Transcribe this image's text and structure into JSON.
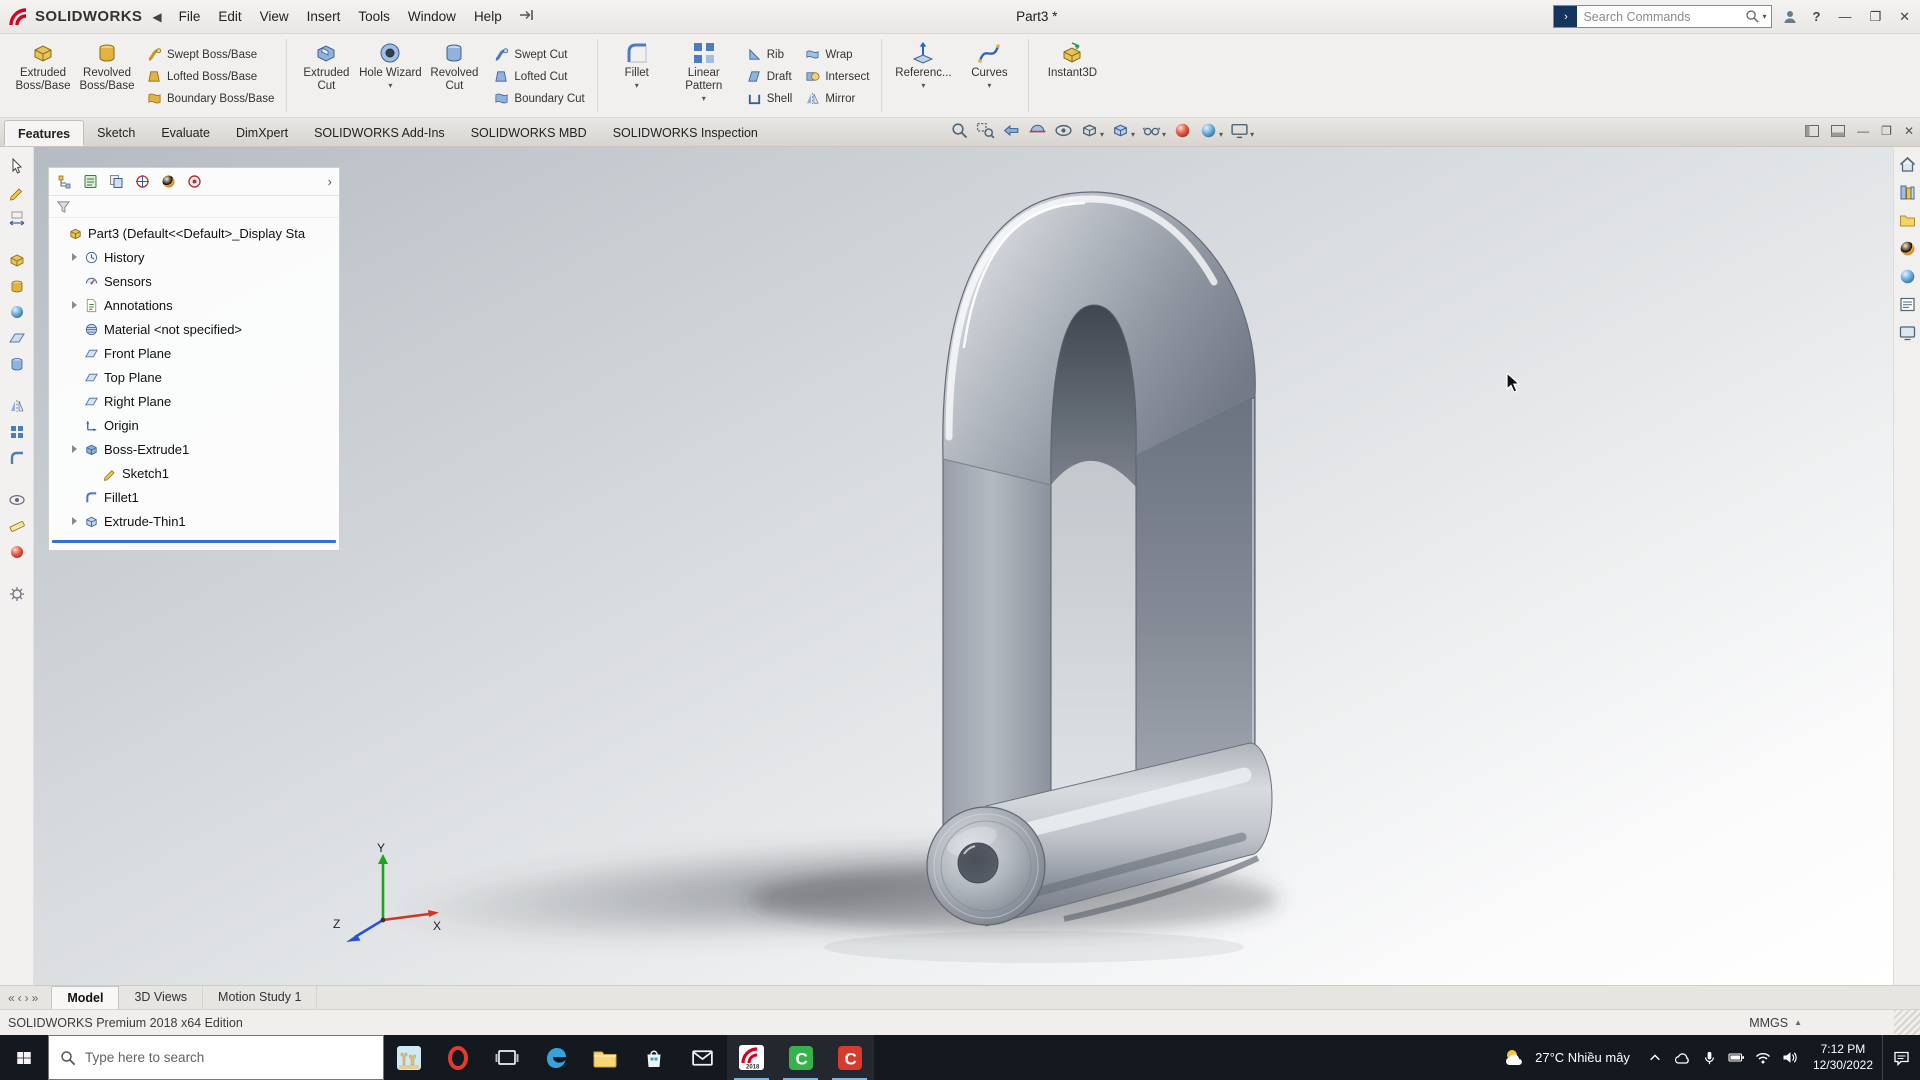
{
  "colors": {
    "accent_blue": "#2a7ecb",
    "brand_red": "#d6001c",
    "feature_gold": "#e3b341",
    "feature_blue": "#4c7cc0",
    "rollback_blue": "#2f74d0",
    "taskbar_bg": "#14181f"
  },
  "titlebar": {
    "app_name": "SOLIDWORKS",
    "document_title": "Part3 *",
    "menu": [
      "File",
      "Edit",
      "View",
      "Insert",
      "Tools",
      "Window",
      "Help"
    ],
    "search_placeholder": "Search Commands",
    "icons": [
      "solidworks-logo",
      "back-arrow",
      "pin-icon",
      "search-icon",
      "user-icon",
      "help-icon",
      "minimize-icon",
      "maximize-icon",
      "close-icon"
    ]
  },
  "ribbon": {
    "groups": [
      {
        "large": [
          "Extruded Boss/Base",
          "Revolved Boss/Base"
        ],
        "small": [
          "Swept Boss/Base",
          "Lofted Boss/Base",
          "Boundary Boss/Base"
        ]
      },
      {
        "large": [
          "Extruded Cut",
          "Hole Wizard",
          "Revolved Cut"
        ],
        "small": [
          "Swept Cut",
          "Lofted Cut",
          "Boundary Cut"
        ]
      },
      {
        "large": [
          "Fillet",
          "Linear Pattern"
        ],
        "small": [
          "Rib",
          "Draft",
          "Shell"
        ],
        "small2": [
          "Wrap",
          "Intersect",
          "Mirror"
        ]
      },
      {
        "large": [
          "Referenc...",
          "Curves"
        ]
      },
      {
        "large": [
          "Instant3D"
        ]
      }
    ]
  },
  "command_tabs": {
    "items": [
      "Features",
      "Sketch",
      "Evaluate",
      "DimXpert",
      "SOLIDWORKS Add-Ins",
      "SOLIDWORKS MBD",
      "SOLIDWORKS Inspection"
    ],
    "active": "Features"
  },
  "headsup_icons": [
    "zoom-fit",
    "zoom-area",
    "previous-view",
    "section-view",
    "annotation-views",
    "view-orientation",
    "display-style",
    "hide-show-items",
    "edit-appearance",
    "apply-scene",
    "view-settings"
  ],
  "feature_tree": {
    "toolbar_icons": [
      "featuremanager-tab",
      "propertymanager-tab",
      "configurationmanager-tab",
      "dimxpertmanager-tab",
      "displaymanager-tab",
      "cam-tab",
      "expand-chevron"
    ],
    "items": [
      {
        "label": "Part3 (Default<<Default>_Display Sta",
        "icon": "part",
        "level": 0,
        "arrow": false
      },
      {
        "label": "History",
        "icon": "history",
        "level": 1,
        "arrow": true
      },
      {
        "label": "Sensors",
        "icon": "sensors",
        "level": 1,
        "arrow": false
      },
      {
        "label": "Annotations",
        "icon": "annotations",
        "level": 1,
        "arrow": true
      },
      {
        "label": "Material <not specified>",
        "icon": "material",
        "level": 1,
        "arrow": false
      },
      {
        "label": "Front Plane",
        "icon": "plane",
        "level": 1,
        "arrow": false
      },
      {
        "label": "Top Plane",
        "icon": "plane",
        "level": 1,
        "arrow": false
      },
      {
        "label": "Right Plane",
        "icon": "plane",
        "level": 1,
        "arrow": false
      },
      {
        "label": "Origin",
        "icon": "origin",
        "level": 1,
        "arrow": false
      },
      {
        "label": "Boss-Extrude1",
        "icon": "boss-extrude",
        "level": 1,
        "arrow": true
      },
      {
        "label": "Sketch1",
        "icon": "sketch",
        "level": 2,
        "arrow": false
      },
      {
        "label": "Fillet1",
        "icon": "fillet",
        "level": 1,
        "arrow": false
      },
      {
        "label": "Extrude-Thin1",
        "icon": "extrude-thin",
        "level": 1,
        "arrow": true
      }
    ]
  },
  "viewport": {
    "triad": {
      "x": "X",
      "y": "Y",
      "z": "Z"
    }
  },
  "left_toolbar_icons": [
    "select",
    "sketch",
    "dimension",
    "extrude",
    "revolve",
    "sphere",
    "plane",
    "cylinder",
    "mirror",
    "pattern",
    "fillet",
    "eye",
    "measure",
    "appearance"
  ],
  "right_taskpane_icons": [
    "home",
    "design-library",
    "file-explorer",
    "appearances",
    "scenes",
    "custom-properties",
    "view-palette"
  ],
  "doc_tabs": {
    "items": [
      "Model",
      "3D Views",
      "Motion Study 1"
    ],
    "active": "Model"
  },
  "status_bar": {
    "message": "SOLIDWORKS Premium 2018 x64 Edition",
    "units": "MMGS"
  },
  "taskbar": {
    "search_placeholder": "Type here to search",
    "apps": [
      "castle",
      "opera",
      "task-view",
      "edge",
      "file-explorer",
      "store",
      "mail",
      "solidworks",
      "c-green",
      "c-red"
    ],
    "tray_icons": [
      "hidden-icons",
      "cloud",
      "microphone",
      "battery",
      "wifi",
      "volume"
    ],
    "tray": {
      "weather": "27°C Nhiều mây",
      "time": "7:12 PM",
      "date": "12/30/2022"
    }
  }
}
